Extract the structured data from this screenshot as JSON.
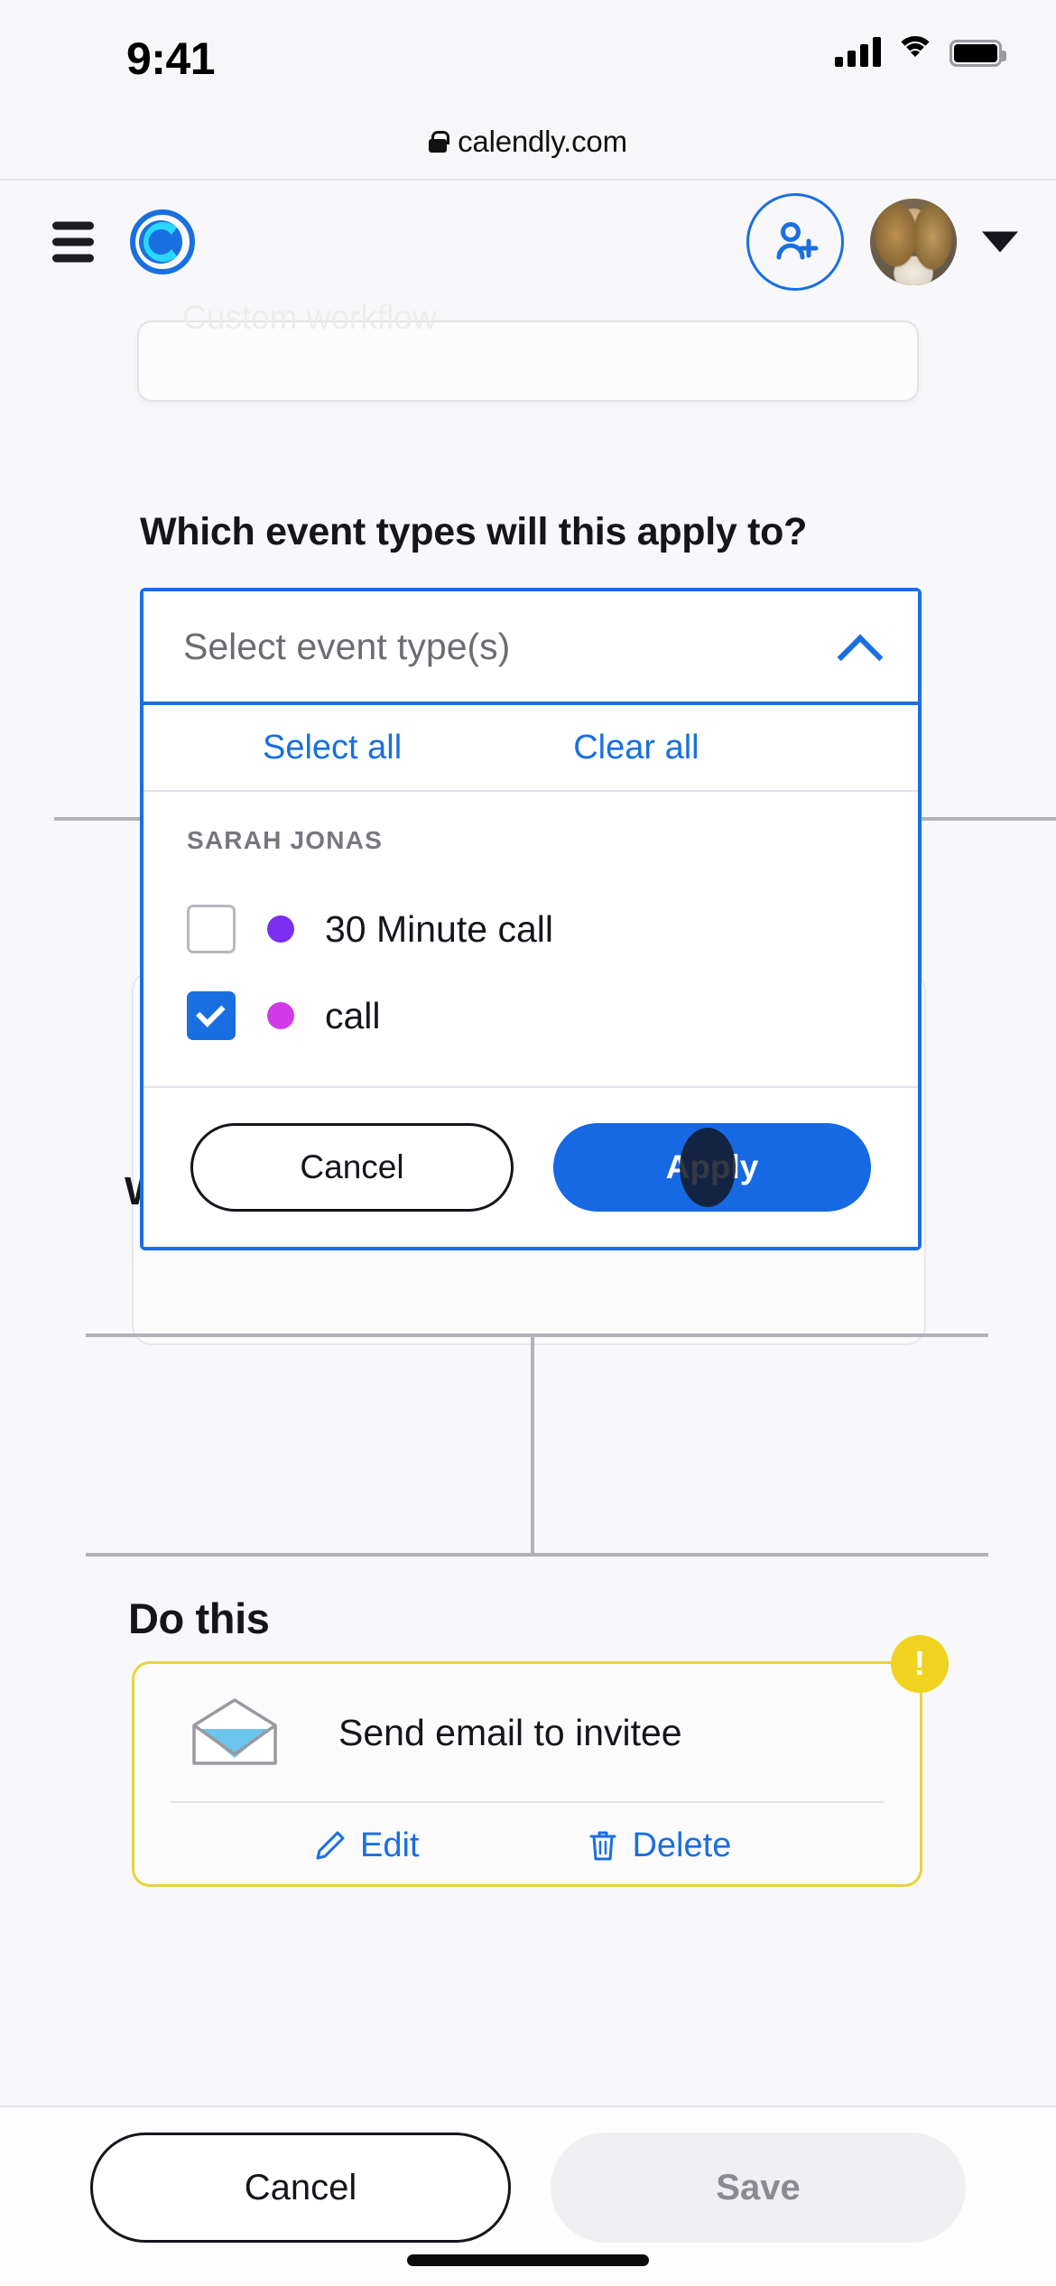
{
  "status_bar": {
    "time": "9:41",
    "signal_icon": "cellular-bars-icon",
    "wifi_icon": "wifi-icon",
    "battery_icon": "battery-icon"
  },
  "browser": {
    "lock_icon": "lock-icon",
    "url": "calendly.com"
  },
  "app_header": {
    "menu_icon": "hamburger-menu-icon",
    "logo_icon": "calendly-logo-icon",
    "add_user_icon": "add-user-icon",
    "avatar_icon": "user-avatar",
    "account_caret_icon": "caret-down-icon"
  },
  "background": {
    "ghost_card_label": "Custom workflow",
    "when_heading_fragment": "W"
  },
  "main": {
    "question": "Which event types will this apply to?"
  },
  "dropdown": {
    "placeholder": "Select event type(s)",
    "chevron_icon": "chevron-up-icon",
    "select_all_label": "Select all",
    "clear_all_label": "Clear all",
    "group_title": "SARAH JONAS",
    "items": [
      {
        "label": "30 Minute call",
        "checked": false,
        "dot_color": "#7b2ff0",
        "checkbox_icon": "checkbox-unchecked-icon"
      },
      {
        "label": "call",
        "checked": true,
        "dot_color": "#d23ae8",
        "checkbox_icon": "checkbox-checked-icon"
      }
    ],
    "cancel_label": "Cancel",
    "apply_label": "Apply",
    "touch_indicator": "touch-point-indicator"
  },
  "do_this": {
    "title": "Do this",
    "card": {
      "warning_badge": "!",
      "warning_icon": "warning-exclamation-icon",
      "mail_icon": "open-envelope-icon",
      "label": "Send email to invitee",
      "edit_icon": "pencil-edit-icon",
      "edit_label": "Edit",
      "delete_icon": "trash-delete-icon",
      "delete_label": "Delete"
    }
  },
  "footer": {
    "cancel_label": "Cancel",
    "save_label": "Save",
    "home_indicator": "home-indicator"
  },
  "colors": {
    "accent_blue": "#1a6fe0",
    "primary_button": "#1668e3",
    "warning_yellow": "#e8d33c",
    "page_bg": "#f8f8fa"
  }
}
